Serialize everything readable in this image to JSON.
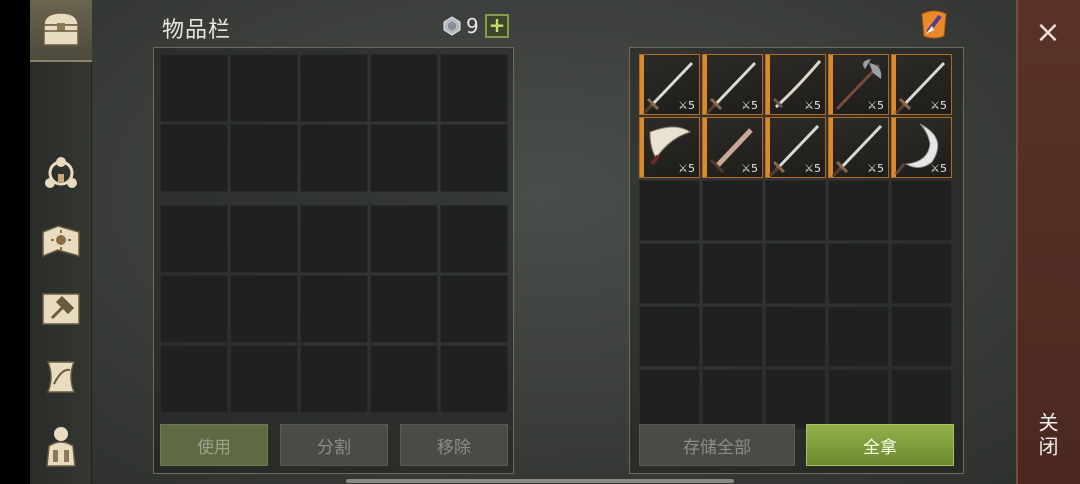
{
  "header": {
    "title": "物品栏",
    "gem_count": "9",
    "plus_label": "+"
  },
  "sidebar": {
    "items": [
      {
        "name": "chest-icon",
        "active": true
      },
      {
        "name": "skills-icon"
      },
      {
        "name": "recipe-book-icon"
      },
      {
        "name": "crafting-icon"
      },
      {
        "name": "quests-icon"
      },
      {
        "name": "character-icon"
      }
    ]
  },
  "inventory": {
    "top_rows": 2,
    "bottom_rows": 3,
    "columns": 5,
    "buttons": {
      "use": "使用",
      "split": "分割",
      "remove": "移除"
    }
  },
  "loot": {
    "items": [
      {
        "icon": "sword-icon",
        "durability": "5"
      },
      {
        "icon": "sword-icon",
        "durability": "5"
      },
      {
        "icon": "katana-icon",
        "durability": "5"
      },
      {
        "icon": "halberd-icon",
        "durability": "5"
      },
      {
        "icon": "sword-icon",
        "durability": "5"
      },
      {
        "icon": "scimitar-icon",
        "durability": "5"
      },
      {
        "icon": "dagger-icon",
        "durability": "5"
      },
      {
        "icon": "sword-icon",
        "durability": "5"
      },
      {
        "icon": "sword-icon",
        "durability": "5"
      },
      {
        "icon": "sickle-icon",
        "durability": "5"
      }
    ],
    "buttons": {
      "store_all": "存储全部",
      "take_all": "全拿"
    }
  },
  "close": {
    "x": "×",
    "label": "关闭"
  },
  "colors": {
    "accent_orange": "#d98a2a",
    "take_green": "#93b04a"
  }
}
